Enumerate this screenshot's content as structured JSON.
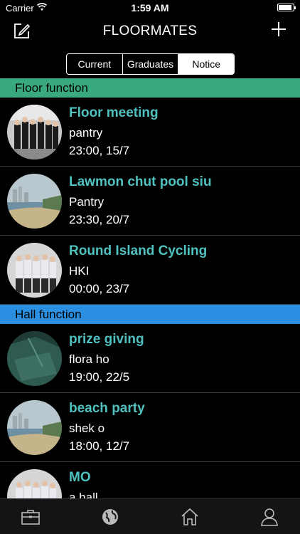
{
  "status_bar": {
    "carrier": "Carrier",
    "time": "1:59 AM"
  },
  "nav": {
    "title": "FLOORMATES",
    "left_icon": "compose-icon",
    "right_icon": "plus-icon"
  },
  "segments": [
    {
      "label": "Current",
      "selected": false
    },
    {
      "label": "Graduates",
      "selected": false
    },
    {
      "label": "Notice",
      "selected": true
    }
  ],
  "sections": [
    {
      "title": "Floor function",
      "color": "#3aa97e",
      "items": [
        {
          "name": "Floor meeting",
          "place": "pantry",
          "when": "23:00, 15/7",
          "avatar": "group-photo"
        },
        {
          "name": "Lawmon chut pool siu",
          "place": "Pantry",
          "when": "23:30, 20/7",
          "avatar": "beach-photo"
        },
        {
          "name": "Round Island Cycling",
          "place": "HKI",
          "when": "00:00, 23/7",
          "avatar": "group-photo"
        }
      ]
    },
    {
      "title": "Hall function",
      "color": "#2a8fe0",
      "items": [
        {
          "name": "prize giving",
          "place": "flora ho",
          "when": "19:00, 22/5",
          "avatar": "green-photo"
        },
        {
          "name": "beach party",
          "place": "shek o",
          "when": "18:00, 12/7",
          "avatar": "beach-photo"
        },
        {
          "name": "MO",
          "place": "a hall",
          "when": "",
          "avatar": "group-photo"
        }
      ]
    }
  ],
  "tab_bar": {
    "tabs": [
      "briefcase-icon",
      "globe-icon",
      "home-icon",
      "person-icon"
    ]
  }
}
